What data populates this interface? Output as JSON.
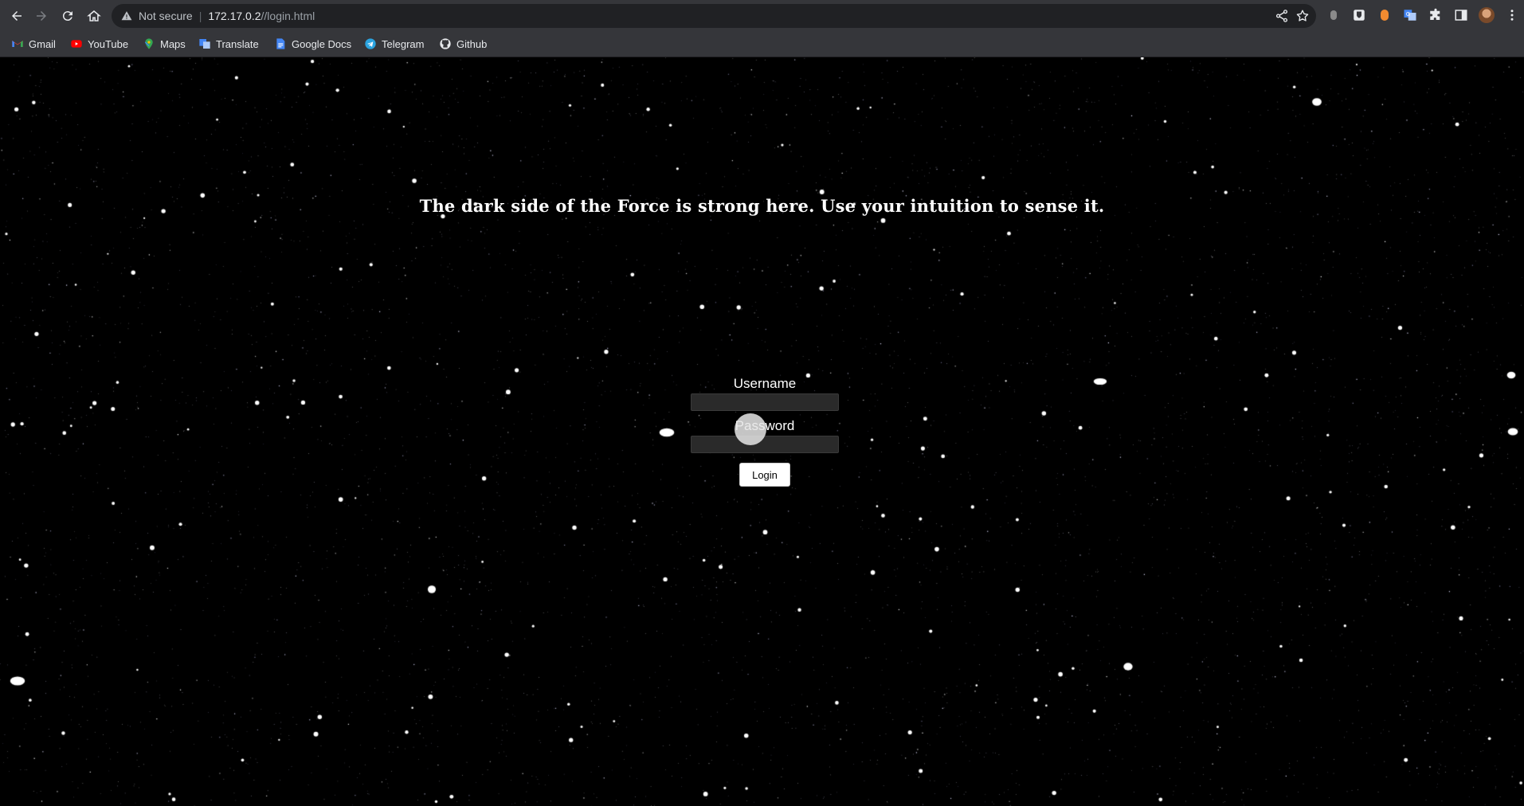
{
  "browser": {
    "security_label": "Not secure",
    "url_host": "172.17.0.2",
    "url_path": "//login.html",
    "bookmarks": [
      {
        "label": "Gmail",
        "icon": "gmail-icon"
      },
      {
        "label": "YouTube",
        "icon": "youtube-icon"
      },
      {
        "label": "Maps",
        "icon": "maps-icon"
      },
      {
        "label": "Translate",
        "icon": "translate-icon"
      },
      {
        "label": "Google Docs",
        "icon": "google-docs-icon"
      },
      {
        "label": "Telegram",
        "icon": "telegram-icon"
      },
      {
        "label": "Github",
        "icon": "github-icon"
      }
    ]
  },
  "page": {
    "headline": "The dark side of the Force is strong here. Use your intuition to sense it.",
    "username_label": "Username",
    "password_label": "Password",
    "username_value": "",
    "password_value": "",
    "login_button": "Login"
  },
  "colors": {
    "chrome_bg": "#35363a",
    "omnibox_bg": "#202124",
    "page_bg": "#000000",
    "text": "#ffffff"
  }
}
